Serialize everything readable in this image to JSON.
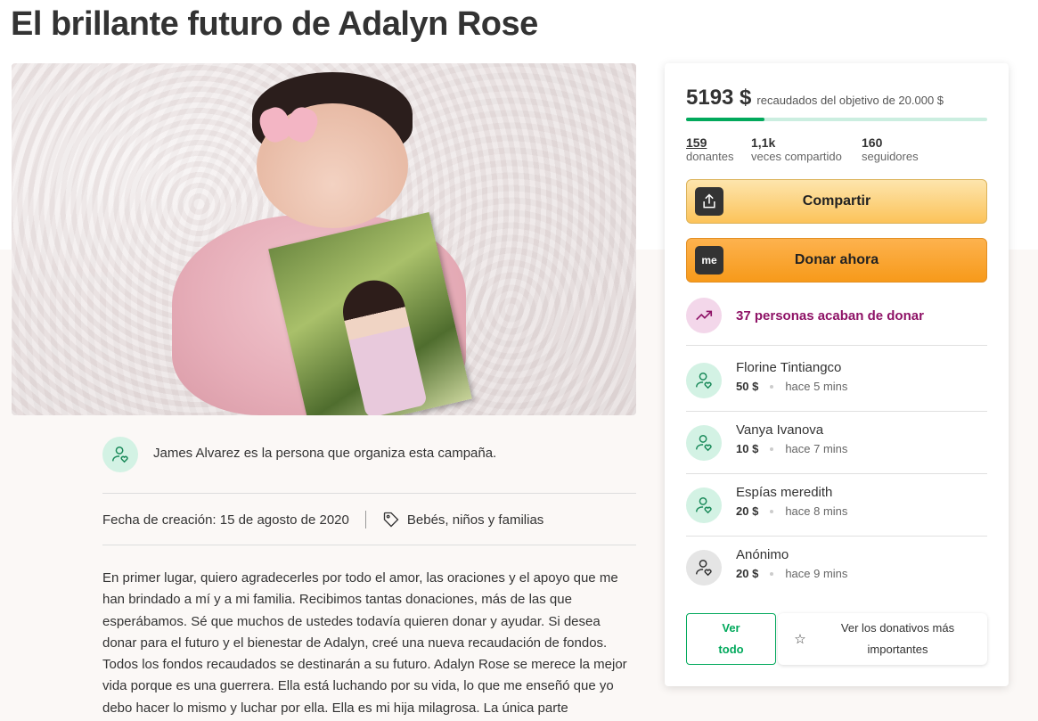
{
  "page": {
    "title": "El brillante futuro de Adalyn Rose"
  },
  "organizer": {
    "text": "James Alvarez es la persona que organiza esta campaña."
  },
  "meta": {
    "created": "Fecha de creación: 15 de agosto de 2020",
    "category": "Bebés, niños y familias"
  },
  "story": {
    "text": "En primer lugar, quiero agradecerles por todo el amor, las oraciones y el apoyo que me han brindado a mí y a mi familia. Recibimos tantas donaciones, más de las que esperábamos. Sé que muchos de ustedes todavía quieren donar y ayudar. Si desea donar para el futuro y el bienestar de Adalyn, creé una nueva recaudación de fondos. Todos los fondos recaudados se destinarán a su futuro. Adalyn Rose se merece la mejor vida porque es una guerrera. Ella está luchando por su vida, lo que me enseñó que yo debo hacer lo mismo y luchar por ella. Ella es mi hija milagrosa. La única parte"
  },
  "campaign": {
    "raised": "5193 $",
    "goal_text": "recaudados del objetivo de 20.000 $",
    "progress_fraction": 0.26,
    "donors_count": "159",
    "donors_label": "donantes",
    "shares_count": "1,1k",
    "shares_label": "veces compartido",
    "followers_count": "160",
    "followers_label": "seguidores",
    "share_label": "Compartir",
    "donate_label": "Donar ahora",
    "donate_icon_text": "me",
    "recent_text": "37 personas acaban de donar",
    "view_all_label": "Ver todo",
    "top_donations_label": "Ver los donativos más importantes"
  },
  "donations": [
    {
      "name": "Florine Tintiangco",
      "amount": "50 $",
      "time": "hace 5 mins"
    },
    {
      "name": "Vanya Ivanova",
      "amount": "10 $",
      "time": "hace 7 mins"
    },
    {
      "name": "Espías meredith",
      "amount": "20 $",
      "time": "hace 8 mins"
    },
    {
      "name": "Anónimo",
      "amount": "20 $",
      "time": "hace 9 mins"
    }
  ],
  "colors": {
    "accent_green": "#02a95c",
    "donate_orange": "#f79a1a",
    "share_yellow": "#fcc35a",
    "recent_purple": "#8e1266"
  },
  "icons": [
    "share-icon",
    "gofundme-icon",
    "trending-up-icon",
    "heart-user-icon",
    "tag-icon",
    "star-icon"
  ]
}
